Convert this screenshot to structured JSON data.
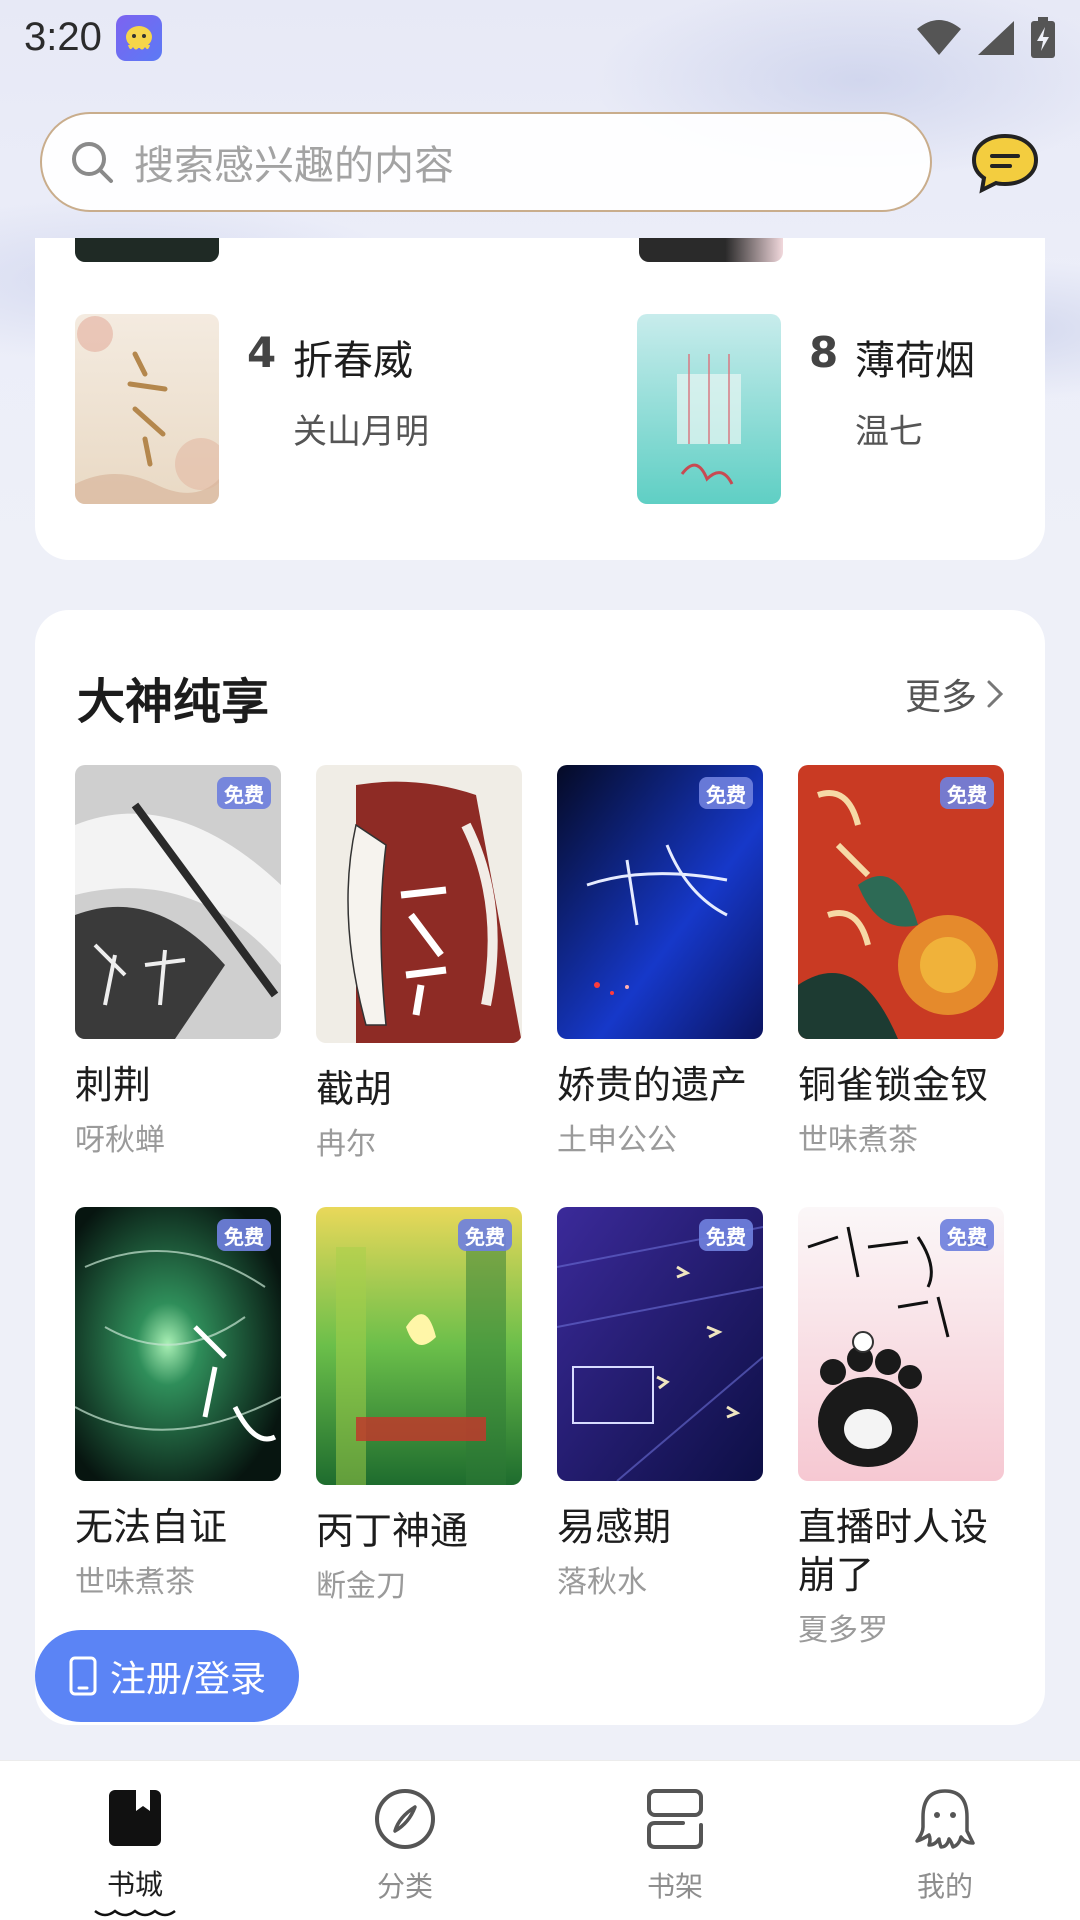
{
  "status_bar": {
    "time": "3:20"
  },
  "search": {
    "placeholder": "搜索感兴趣的内容"
  },
  "ranking": {
    "items": [
      {
        "rank": "4",
        "title": "折春威",
        "author": "关山月明"
      },
      {
        "rank": "8",
        "title": "薄荷烟",
        "author": "温七"
      }
    ]
  },
  "section": {
    "title": "大神纯享",
    "more_label": "更多",
    "free_label": "免费",
    "books": [
      {
        "title": "刺荆",
        "author": "呀秋蝉",
        "free": true
      },
      {
        "title": "截胡",
        "author": "冉尔",
        "free": false
      },
      {
        "title": "娇贵的遗产",
        "author": "土申公公",
        "free": true
      },
      {
        "title": "铜雀锁金钗",
        "author": "世味煮茶",
        "free": true
      },
      {
        "title": "无法自证",
        "author": "世味煮茶",
        "free": true
      },
      {
        "title": "丙丁神通",
        "author": "断金刀",
        "free": true
      },
      {
        "title": "易感期",
        "author": "落秋水",
        "free": true
      },
      {
        "title": "直播时人设崩了",
        "author": "夏多罗",
        "free": true
      }
    ]
  },
  "login_button": {
    "label": "注册/登录"
  },
  "bottom_nav": {
    "items": [
      {
        "label": "书城",
        "active": true
      },
      {
        "label": "分类",
        "active": false
      },
      {
        "label": "书架",
        "active": false
      },
      {
        "label": "我的",
        "active": false
      }
    ]
  },
  "colors": {
    "accent": "#5b84f5",
    "free_badge": "#6f80dd",
    "search_border": "#c9ad8c"
  }
}
